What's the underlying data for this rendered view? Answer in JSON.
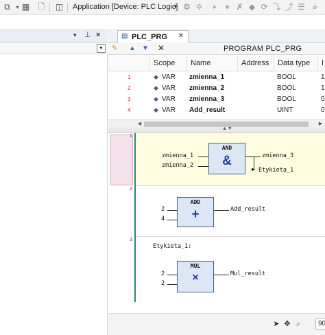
{
  "toolbar": {
    "application_label": "Application [Device: PLC Logic]",
    "icons": [
      "dropdown-icon",
      "grid-icon",
      "page-icon",
      "window-icon",
      "login-icon",
      "logout-icon",
      "start-icon",
      "stop-icon",
      "reset-icon",
      "breakpoint-icon",
      "step-over-icon",
      "step-into-icon",
      "step-out-icon",
      "search-icon"
    ]
  },
  "left_panel": {
    "icons": [
      "pin-icon",
      "close-icon",
      "dropdown-icon"
    ]
  },
  "editor": {
    "tab_label": "PLC_PRG",
    "program_title": "PROGRAM PLC_PRG",
    "columns": [
      "Scope",
      "Name",
      "Address",
      "Data type",
      "I"
    ],
    "variables": [
      {
        "num": "1",
        "scope": "VAR",
        "name": "zmienna_1",
        "type": "BOOL",
        "init": "1"
      },
      {
        "num": "2",
        "scope": "VAR",
        "name": "zmienna_2",
        "type": "BOOL",
        "init": "1"
      },
      {
        "num": "3",
        "scope": "VAR",
        "name": "zmienna_3",
        "type": "BOOL",
        "init": "0"
      },
      {
        "num": "4",
        "scope": "VAR",
        "name": "Add_result",
        "type": "UINT",
        "init": "0"
      }
    ]
  },
  "networks": [
    {
      "number": "1",
      "block": {
        "name": "AND",
        "symbol": "&"
      },
      "inputs": [
        "zmienna_1",
        "zmienna_2"
      ],
      "output": "zmienna_3",
      "jump_label": "Etykieta_1"
    },
    {
      "number": "2",
      "block": {
        "name": "ADD",
        "symbol": "+"
      },
      "inputs": [
        "2",
        "4"
      ],
      "output": "Add_result"
    },
    {
      "number": "3",
      "label": "Etykieta_1:",
      "block": {
        "name": "MUL",
        "symbol": "×"
      },
      "inputs": [
        "2",
        "2"
      ],
      "output": "Mul_result"
    }
  ],
  "bottom_bar": {
    "zoom_value": "90"
  },
  "colors": {
    "network_selected_bg": "#fffde0",
    "gutter_line": "#1c8a80",
    "block_fill": "#dce7f5",
    "block_symbol": "#1e3f9a"
  }
}
